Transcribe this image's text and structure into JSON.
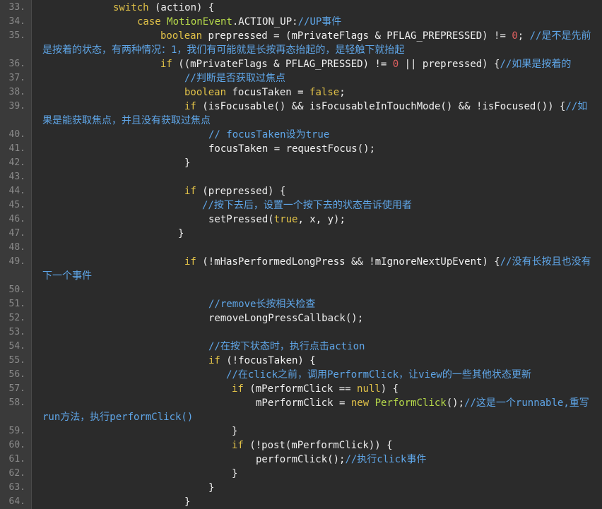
{
  "editor": {
    "theme_colors": {
      "background": "#2b2b2b",
      "gutter": "#3a3a3a",
      "line_number": "#8a8a8a",
      "text": "#f0f0f0",
      "keyword": "#e0c148",
      "type": "#b6d94a",
      "comment": "#5fa6e8",
      "number": "#e06060"
    },
    "lines": [
      {
        "num": "33.",
        "indent": 100,
        "segments": [
          {
            "t": "switch",
            "c": "kw"
          },
          {
            "t": " (action) {",
            "c": ""
          }
        ]
      },
      {
        "num": "34.",
        "indent": 134,
        "segments": [
          {
            "t": "case",
            "c": "kw"
          },
          {
            "t": " ",
            "c": ""
          },
          {
            "t": "MotionEvent",
            "c": "ty"
          },
          {
            "t": ".ACTION_UP:",
            "c": ""
          },
          {
            "t": "//UP事件",
            "c": "cm"
          }
        ]
      },
      {
        "num": "35.",
        "indent": 167,
        "segments": [
          {
            "t": "boolean",
            "c": "kw"
          },
          {
            "t": " prepressed = (mPrivateFlags & PFLAG_PREPRESSED) != ",
            "c": ""
          },
          {
            "t": "0",
            "c": "num"
          },
          {
            "t": "; ",
            "c": ""
          },
          {
            "t": "//是不是先前",
            "c": "cm"
          }
        ]
      },
      {
        "num": "",
        "indent": 0,
        "segments": [
          {
            "t": "是按着的状态，有两种情况：1，我们有可能就是长按再态抬起的，是轻触下就抬起",
            "c": "cm"
          }
        ]
      },
      {
        "num": "36.",
        "indent": 167,
        "segments": [
          {
            "t": "if",
            "c": "kw"
          },
          {
            "t": " ((mPrivateFlags & PFLAG_PRESSED) != ",
            "c": ""
          },
          {
            "t": "0",
            "c": "num"
          },
          {
            "t": " || prepressed) {",
            "c": ""
          },
          {
            "t": "//如果是按着的",
            "c": "cm"
          }
        ]
      },
      {
        "num": "37.",
        "indent": 201,
        "segments": [
          {
            "t": "//判断是否获取过焦点",
            "c": "cm"
          }
        ]
      },
      {
        "num": "38.",
        "indent": 201,
        "segments": [
          {
            "t": "boolean",
            "c": "kw"
          },
          {
            "t": " focusTaken = ",
            "c": ""
          },
          {
            "t": "false",
            "c": "kw"
          },
          {
            "t": ";",
            "c": ""
          }
        ]
      },
      {
        "num": "39.",
        "indent": 201,
        "segments": [
          {
            "t": "if",
            "c": "kw"
          },
          {
            "t": " (isFocusable() && isFocusableInTouchMode() && !isFocused()) {",
            "c": ""
          },
          {
            "t": "//如",
            "c": "cm"
          }
        ]
      },
      {
        "num": "",
        "indent": 0,
        "segments": [
          {
            "t": "果是能获取焦点，并且没有获取过焦点",
            "c": "cm"
          }
        ]
      },
      {
        "num": "40.",
        "indent": 235,
        "segments": [
          {
            "t": "// focusTaken设为true",
            "c": "cm"
          }
        ]
      },
      {
        "num": "41.",
        "indent": 235,
        "segments": [
          {
            "t": "focusTaken = requestFocus();",
            "c": ""
          }
        ]
      },
      {
        "num": "42.",
        "indent": 201,
        "segments": [
          {
            "t": "}",
            "c": ""
          }
        ]
      },
      {
        "num": "43.",
        "indent": 0,
        "segments": []
      },
      {
        "num": "44.",
        "indent": 201,
        "segments": [
          {
            "t": "if",
            "c": "kw"
          },
          {
            "t": " (prepressed) {",
            "c": ""
          }
        ]
      },
      {
        "num": "45.",
        "indent": 226,
        "segments": [
          {
            "t": "//按下去后，设置一个按下去的状态告诉使用者",
            "c": "cm"
          }
        ]
      },
      {
        "num": "46.",
        "indent": 235,
        "segments": [
          {
            "t": "setPressed(",
            "c": ""
          },
          {
            "t": "true",
            "c": "kw"
          },
          {
            "t": ", x, y);",
            "c": ""
          }
        ]
      },
      {
        "num": "47.",
        "indent": 192,
        "segments": [
          {
            "t": "}",
            "c": ""
          }
        ]
      },
      {
        "num": "48.",
        "indent": 0,
        "segments": []
      },
      {
        "num": "49.",
        "indent": 201,
        "segments": [
          {
            "t": "if",
            "c": "kw"
          },
          {
            "t": " (!mHasPerformedLongPress && !mIgnoreNextUpEvent) {",
            "c": ""
          },
          {
            "t": "//没有长按且也没有",
            "c": "cm"
          }
        ]
      },
      {
        "num": "",
        "indent": 0,
        "segments": [
          {
            "t": "下一个事件",
            "c": "cm"
          }
        ]
      },
      {
        "num": "50.",
        "indent": 0,
        "segments": []
      },
      {
        "num": "51.",
        "indent": 235,
        "segments": [
          {
            "t": "//remove长按相关检查",
            "c": "cm"
          }
        ]
      },
      {
        "num": "52.",
        "indent": 235,
        "segments": [
          {
            "t": "removeLongPressCallback();",
            "c": ""
          }
        ]
      },
      {
        "num": "53.",
        "indent": 0,
        "segments": []
      },
      {
        "num": "54.",
        "indent": 235,
        "segments": [
          {
            "t": "//在按下状态时，执行点击action",
            "c": "cm"
          }
        ]
      },
      {
        "num": "55.",
        "indent": 235,
        "segments": [
          {
            "t": "if",
            "c": "kw"
          },
          {
            "t": " (!focusTaken) {",
            "c": ""
          }
        ]
      },
      {
        "num": "56.",
        "indent": 260,
        "segments": [
          {
            "t": "//在click之前，调用PerformClick，让view的一些其他状态更新",
            "c": "cm"
          }
        ]
      },
      {
        "num": "57.",
        "indent": 268,
        "segments": [
          {
            "t": "if",
            "c": "kw"
          },
          {
            "t": " (mPerformClick == ",
            "c": ""
          },
          {
            "t": "null",
            "c": "kw"
          },
          {
            "t": ") {",
            "c": ""
          }
        ]
      },
      {
        "num": "58.",
        "indent": 302,
        "segments": [
          {
            "t": "mPerformClick = ",
            "c": ""
          },
          {
            "t": "new",
            "c": "kw"
          },
          {
            "t": " ",
            "c": ""
          },
          {
            "t": "PerformClick",
            "c": "ty"
          },
          {
            "t": "();",
            "c": ""
          },
          {
            "t": "//这是一个runnable,重写",
            "c": "cm"
          }
        ]
      },
      {
        "num": "",
        "indent": 0,
        "segments": [
          {
            "t": "run方法，执行performClick()",
            "c": "cm"
          }
        ]
      },
      {
        "num": "59.",
        "indent": 268,
        "segments": [
          {
            "t": "}",
            "c": ""
          }
        ]
      },
      {
        "num": "60.",
        "indent": 268,
        "segments": [
          {
            "t": "if",
            "c": "kw"
          },
          {
            "t": " (!post(mPerformClick)) {",
            "c": ""
          }
        ]
      },
      {
        "num": "61.",
        "indent": 302,
        "segments": [
          {
            "t": "performClick();",
            "c": ""
          },
          {
            "t": "//执行click事件",
            "c": "cm"
          }
        ]
      },
      {
        "num": "62.",
        "indent": 268,
        "segments": [
          {
            "t": "}",
            "c": ""
          }
        ]
      },
      {
        "num": "63.",
        "indent": 235,
        "segments": [
          {
            "t": "}",
            "c": ""
          }
        ]
      },
      {
        "num": "64.",
        "indent": 201,
        "segments": [
          {
            "t": "}",
            "c": ""
          }
        ]
      }
    ]
  }
}
